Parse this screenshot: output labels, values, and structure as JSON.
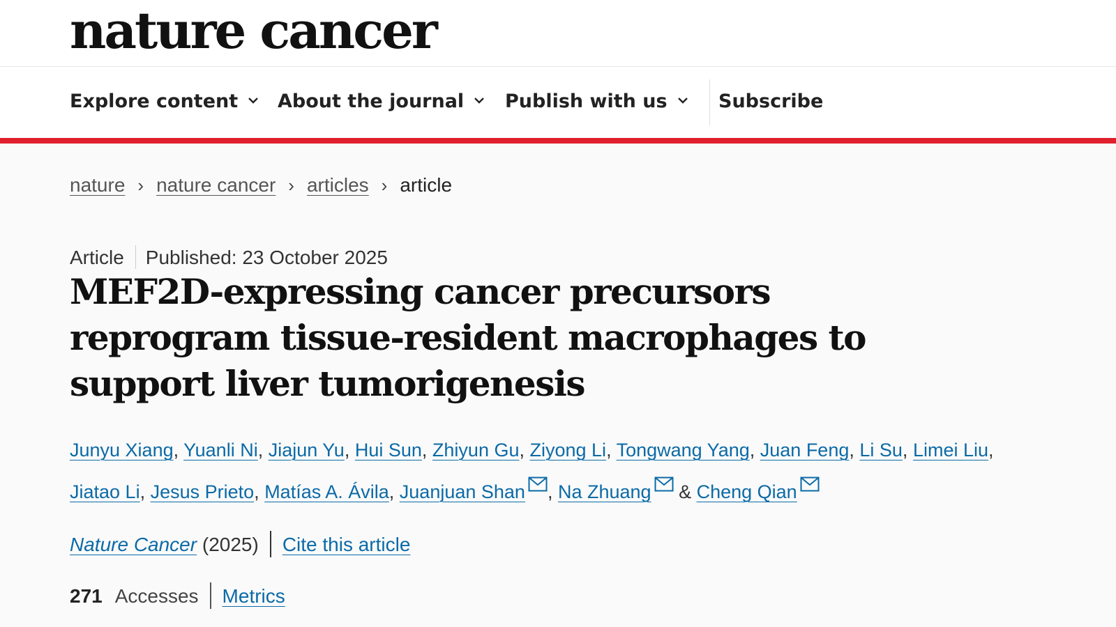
{
  "header": {
    "logo_text": "nature cancer"
  },
  "nav": {
    "items": [
      {
        "label": "Explore content",
        "has_dropdown": true
      },
      {
        "label": "About the journal",
        "has_dropdown": true
      },
      {
        "label": "Publish with us",
        "has_dropdown": true
      },
      {
        "label": "Subscribe",
        "has_dropdown": false
      }
    ]
  },
  "breadcrumb": {
    "items": [
      "nature",
      "nature cancer",
      "articles"
    ],
    "current": "article",
    "separator": "›"
  },
  "article": {
    "type": "Article",
    "published": "Published: 23 October 2025",
    "title": "MEF2D-expressing cancer precursors reprogram tissue-resident macrophages to support liver tumorigenesis",
    "authors": [
      {
        "name": "Junyu Xiang",
        "corresponding": false
      },
      {
        "name": "Yuanli Ni",
        "corresponding": false
      },
      {
        "name": "Jiajun Yu",
        "corresponding": false
      },
      {
        "name": "Hui Sun",
        "corresponding": false
      },
      {
        "name": "Zhiyun Gu",
        "corresponding": false
      },
      {
        "name": "Ziyong Li",
        "corresponding": false
      },
      {
        "name": "Tongwang Yang",
        "corresponding": false
      },
      {
        "name": "Juan Feng",
        "corresponding": false
      },
      {
        "name": "Li Su",
        "corresponding": false
      },
      {
        "name": "Limei Liu",
        "corresponding": false
      },
      {
        "name": "Jiatao Li",
        "corresponding": false
      },
      {
        "name": "Jesus Prieto",
        "corresponding": false
      },
      {
        "name": "Matías A. Ávila",
        "corresponding": false
      },
      {
        "name": "Juanjuan Shan",
        "corresponding": true
      },
      {
        "name": "Na Zhuang",
        "corresponding": true
      },
      {
        "name": "Cheng Qian",
        "corresponding": true
      }
    ],
    "author_joiner": "&",
    "journal_name": "Nature Cancer",
    "year": "(2025)",
    "cite_label": "Cite this article",
    "accesses_count": "271",
    "accesses_label": "Accesses",
    "metrics_label": "Metrics"
  },
  "colors": {
    "accent_red": "#e0202e",
    "link_blue": "#0b6aa7"
  },
  "icons": {
    "dropdown": "chevron-down-icon",
    "email": "envelope-icon"
  }
}
